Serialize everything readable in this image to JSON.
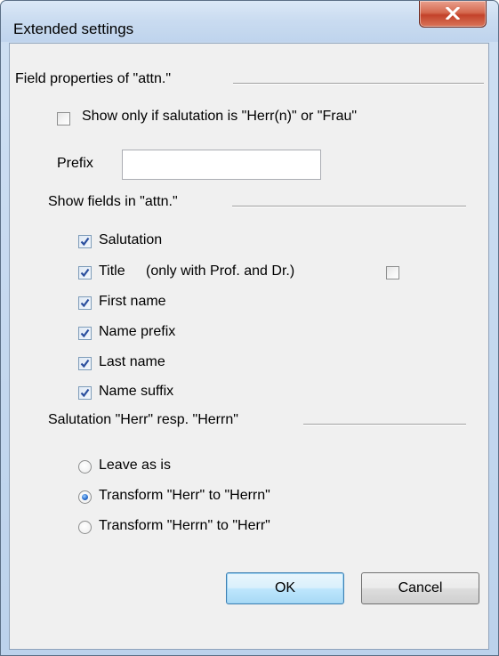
{
  "window": {
    "title": "Extended settings",
    "close_icon": "close-x-icon"
  },
  "field_props": {
    "group_title": "Field properties of \"attn.\"",
    "show_only_label": "Show only if salutation is \"Herr(n)\" or \"Frau\"",
    "show_only_checked": false,
    "prefix_label": "Prefix",
    "prefix_value": ""
  },
  "show_fields": {
    "group_title": "Show fields in \"attn.\"",
    "items": [
      {
        "label": "Salutation",
        "checked": true
      },
      {
        "label": "Title",
        "checked": true
      },
      {
        "label": "First name",
        "checked": true
      },
      {
        "label": "Name prefix",
        "checked": true
      },
      {
        "label": "Last name",
        "checked": true
      },
      {
        "label": "Name suffix",
        "checked": true
      }
    ],
    "title_extra_label": "(only with Prof. and Dr.)",
    "title_extra_checked": false
  },
  "salutation": {
    "group_title": "Salutation \"Herr\" resp. \"Herrn\"",
    "options": [
      {
        "label": "Leave as is",
        "selected": false
      },
      {
        "label": "Transform \"Herr\" to \"Herrn\"",
        "selected": true
      },
      {
        "label": "Transform \"Herrn\" to \"Herr\"",
        "selected": false
      }
    ]
  },
  "buttons": {
    "ok": "OK",
    "cancel": "Cancel"
  },
  "colors": {
    "frame": "#c3d7ee",
    "client": "#f0f0f0",
    "close_button": "#c3422a",
    "check_mark": "#2b4f9e",
    "radio_dot": "#2a6fcf"
  }
}
